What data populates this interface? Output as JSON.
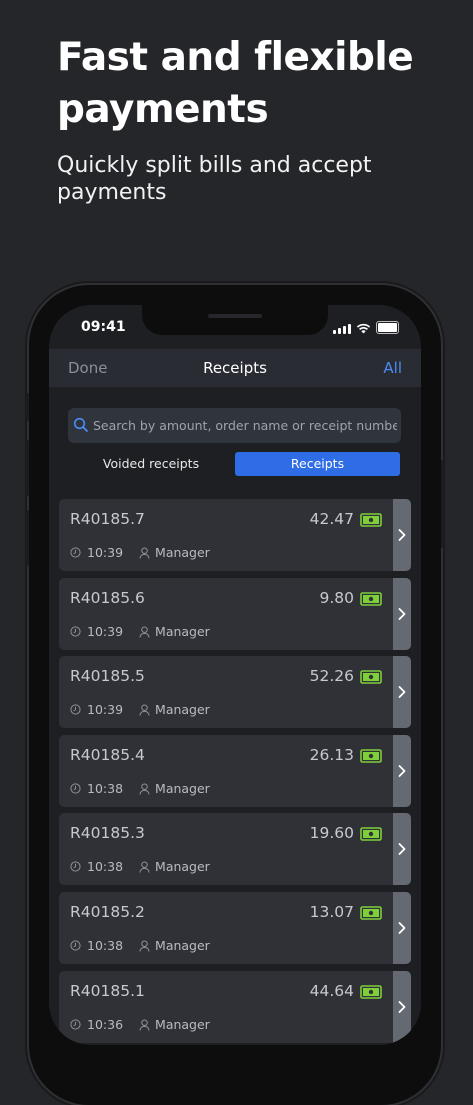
{
  "promo": {
    "headline": "Fast and flexible payments",
    "subheadline": "Quickly split bills and accept payments"
  },
  "status_bar": {
    "time": "09:41"
  },
  "nav": {
    "left": "Done",
    "title": "Receipts",
    "right": "All"
  },
  "search": {
    "placeholder": "Search by amount, order name or receipt number",
    "icon": "search-icon"
  },
  "segments": {
    "voided": "Voided receipts",
    "receipts": "Receipts",
    "selected": "Receipts"
  },
  "colors": {
    "accent": "#2f6de6",
    "link": "#4a8cf5",
    "cash_icon": "#7fcf3a"
  },
  "receipts": [
    {
      "number": "R40185.7",
      "amount": "42.47",
      "time": "10:39",
      "user": "Manager"
    },
    {
      "number": "R40185.6",
      "amount": "9.80",
      "time": "10:39",
      "user": "Manager"
    },
    {
      "number": "R40185.5",
      "amount": "52.26",
      "time": "10:39",
      "user": "Manager"
    },
    {
      "number": "R40185.4",
      "amount": "26.13",
      "time": "10:38",
      "user": "Manager"
    },
    {
      "number": "R40185.3",
      "amount": "19.60",
      "time": "10:38",
      "user": "Manager"
    },
    {
      "number": "R40185.2",
      "amount": "13.07",
      "time": "10:38",
      "user": "Manager"
    },
    {
      "number": "R40185.1",
      "amount": "44.64",
      "time": "10:36",
      "user": "Manager"
    }
  ]
}
